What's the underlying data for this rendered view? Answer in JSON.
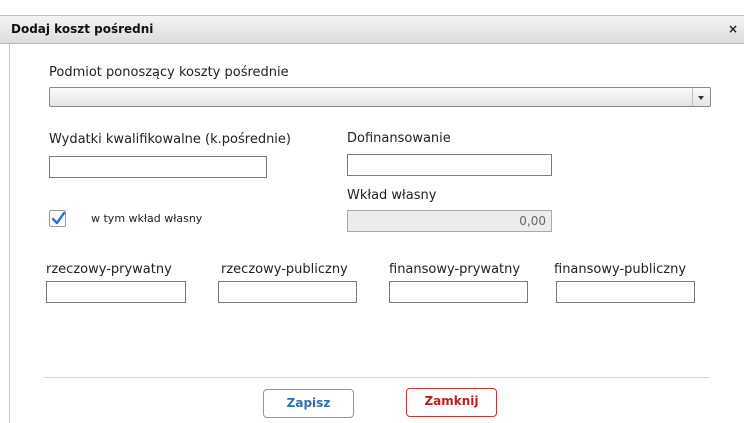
{
  "dialog": {
    "title": "Dodaj koszt pośredni",
    "close_symbol": "×"
  },
  "form": {
    "entity_label": "Podmiot ponoszący koszty pośrednie",
    "entity_value": "",
    "qualified_label": "Wydatki kwalifikowalne (k.pośrednie)",
    "qualified_value": "",
    "cofinancing_label": "Dofinansowanie",
    "cofinancing_value": "",
    "own_contribution_label": "Wkład własny",
    "own_contribution_value": "0,00",
    "include_own_label": "w tym wkład własny",
    "include_own_checked": true,
    "contributions": [
      {
        "label": "rzeczowy-prywatny",
        "value": ""
      },
      {
        "label": "rzeczowy-publiczny",
        "value": ""
      },
      {
        "label": "finansowy-prywatny",
        "value": ""
      },
      {
        "label": "finansowy-publiczny",
        "value": ""
      }
    ]
  },
  "actions": {
    "save_label": "Zapisz",
    "close_label": "Zamknij"
  },
  "colors": {
    "checkbox_check": "#2f6fd8",
    "save_accent": "#2a6fb8",
    "close_accent": "#c41a1a"
  }
}
